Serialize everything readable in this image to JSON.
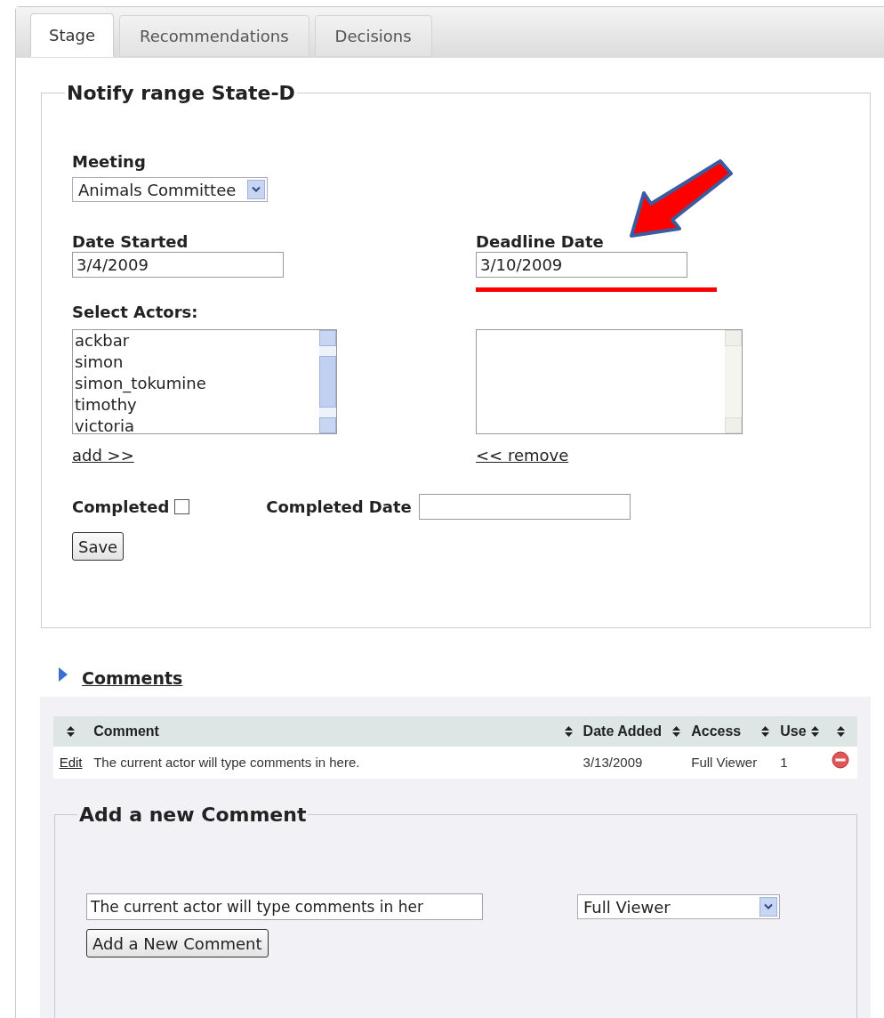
{
  "tabs": [
    {
      "label": "Stage",
      "selected": true
    },
    {
      "label": "Recommendations",
      "selected": false
    },
    {
      "label": "Decisions",
      "selected": false
    }
  ],
  "stage_form": {
    "legend": "Notify range State-D",
    "meeting": {
      "label": "Meeting",
      "value": "Animals Committee"
    },
    "date_started": {
      "label": "Date Started",
      "value": "3/4/2009"
    },
    "deadline_date": {
      "label": "Deadline Date",
      "value": "3/10/2009"
    },
    "select_actors": {
      "label": "Select Actors:",
      "available": [
        "ackbar",
        "simon",
        "simon_tokumine",
        "timothy",
        "victoria"
      ],
      "add_link": "add >>",
      "remove_link": "<< remove"
    },
    "completed": {
      "label": "Completed",
      "checked": false
    },
    "completed_date": {
      "label": "Completed Date"
    },
    "save_button": "Save"
  },
  "comments": {
    "title": "Comments",
    "expanded": false,
    "table": {
      "columns": [
        {
          "kind": "sort-only"
        },
        {
          "kind": "text",
          "label": "Comment"
        },
        {
          "kind": "text",
          "label": "Date Added"
        },
        {
          "kind": "text",
          "label": "Access"
        },
        {
          "kind": "text",
          "label": "Use"
        },
        {
          "kind": "sort-only"
        }
      ],
      "rows": [
        {
          "edit": "Edit",
          "comment": "The current actor will type comments in here.",
          "date_added": "3/13/2009",
          "access": "Full Viewer",
          "use": "1"
        }
      ]
    },
    "add_form": {
      "legend": "Add a new Comment",
      "comment_value": "The current actor will type comments in her",
      "access_value": "Full Viewer",
      "button": "Add a New Comment"
    }
  }
}
